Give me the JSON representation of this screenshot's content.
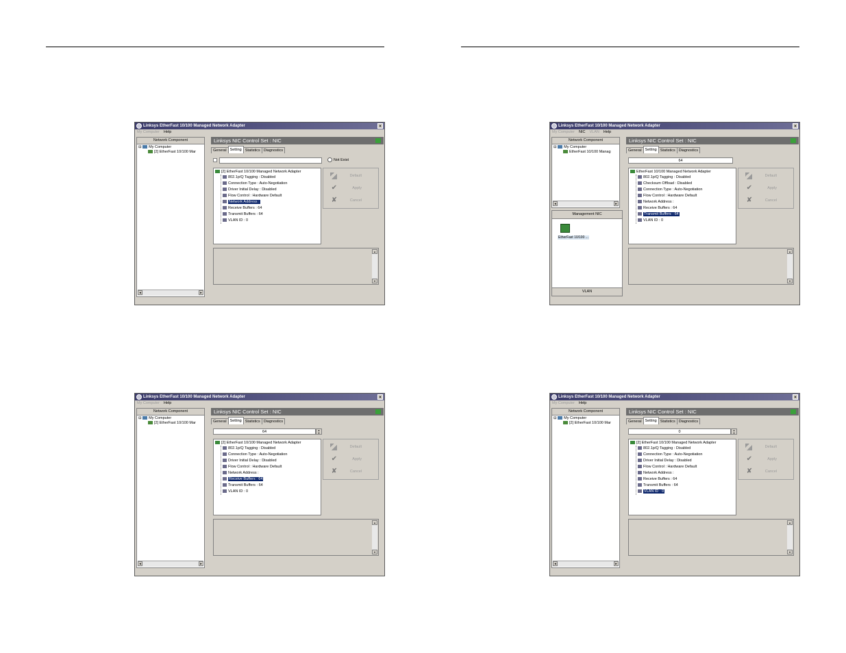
{
  "screens": [
    {
      "title": "Linksys EtherFast 10/100 Managed Network Adapter",
      "menu": [
        "My Computer",
        "Help"
      ],
      "tree_root": "My Computer",
      "tree_child": "[2] EtherFast 10/100 Mar",
      "value": "",
      "radio": "Not Exist",
      "list_header": "[2] EtherFast 10/100 Managed Network Adapter",
      "items": [
        "802.1p/Q Tagging : Disabled",
        "Connection Type : Auto-Negotiation",
        "Driver Initial Delay : Disabled",
        "Flow Control : Hardware Default",
        "Network Address :",
        "Receive Buffers : 64",
        "Transmit Buffers : 64",
        "VLAN ID : 0"
      ],
      "selected": 4
    },
    {
      "title": "Linksys EtherFast 10/100 Managed Network Adapter",
      "menu": [
        "My Computer",
        "NIC",
        "VLAN",
        "Help"
      ],
      "tree_root": "My Computer",
      "tree_child": "EtherFast 10/100 Manag",
      "value": "64",
      "list_header": "EtherFast 10/100 Managed Network Adapter",
      "items": [
        "802.1p/Q Tagging : Disabled",
        "Checksum Offload : Disabled",
        "Connection Type : Auto-Negotiation",
        "Flow Control : Hardware Default",
        "Network Address :",
        "Receive Buffers : 64",
        "Transmit Buffers : 64",
        "VLAN ID : 0"
      ],
      "selected": 6,
      "management_title": "Management NIC",
      "management_label": "EtherFast 10/100 ...",
      "management_footer": "VLAN"
    },
    {
      "title": "Linksys EtherFast 10/100 Managed Network Adapter",
      "menu": [
        "My Computer",
        "Help"
      ],
      "tree_root": "My Computer",
      "tree_child": "[2] EtherFast 10/100 Mar",
      "value": "64",
      "list_header": "[2] EtherFast 10/100 Managed Network Adapter",
      "items": [
        "802.1p/Q Tagging : Disabled",
        "Connection Type : Auto-Negotiation",
        "Driver Initial Delay : Disabled",
        "Flow Control : Hardware Default",
        "Network Address :",
        "Receive Buffers : 64",
        "Transmit Buffers : 64",
        "VLAN ID : 0"
      ],
      "selected": 5
    },
    {
      "title": "Linksys EtherFast 10/100 Managed Network Adapter",
      "menu": [
        "My Computer",
        "Help"
      ],
      "tree_root": "My Computer",
      "tree_child": "[2] EtherFast 10/100 Mar",
      "value": "0",
      "list_header": "[2] EtherFast 10/100 Managed Network Adapter",
      "items": [
        "802.1p/Q Tagging : Disabled",
        "Connection Type : Auto-Negotiation",
        "Driver Initial Delay : Disabled",
        "Flow Control : Hardware Default",
        "Network Address :",
        "Receive Buffers : 64",
        "Transmit Buffers : 64",
        "VLAN ID : 0"
      ],
      "selected": 7
    }
  ],
  "common": {
    "network_component": "Network Component",
    "panel_title": "Linksys NIC Control Set : NIC",
    "tabs": [
      "General",
      "Setting",
      "Statistics",
      "Diagnostics"
    ],
    "buttons": [
      "Default",
      "Apply",
      "Cancel"
    ]
  }
}
